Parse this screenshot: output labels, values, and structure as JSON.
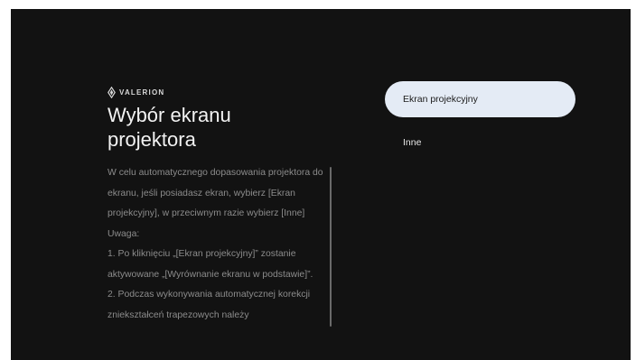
{
  "brand": {
    "logo_icon": "valerion-diamond-logo-icon",
    "name": "VALERION"
  },
  "page": {
    "title": "Wybór ekranu projektora"
  },
  "description": {
    "paragraphs": [
      "W celu automatycznego dopasowania projektora do ekranu, jeśli posiadasz ekran, wybierz [Ekran projekcyjny], w przeciwnym razie wybierz [Inne]",
      "Uwaga:",
      "1. Po kliknięciu „[Ekran projekcyjny]” zostanie aktywowane „[Wyrównanie ekranu w podstawie]”.",
      "2. Podczas wykonywania automatycznej korekcji zniekształceń trapezowych należy"
    ]
  },
  "options": [
    {
      "label": "Ekran projekcyjny",
      "selected": true
    },
    {
      "label": "Inne",
      "selected": false
    }
  ],
  "colors": {
    "background": "#121212",
    "selected_option_bg": "#e4ebf5",
    "body_text": "#8c8c8c",
    "title_text": "#f2f2f2"
  }
}
